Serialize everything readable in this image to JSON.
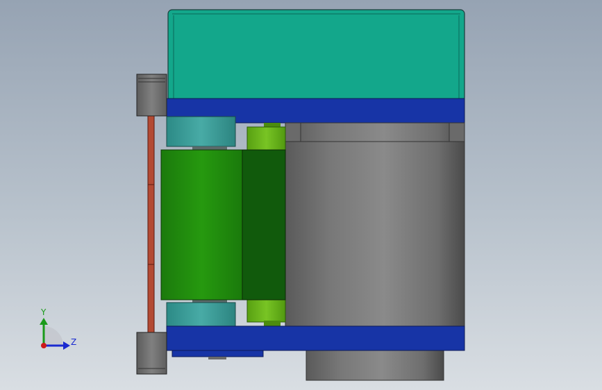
{
  "viewport": {
    "background_top": "#96a3b3",
    "background_bottom": "#d9dee3"
  },
  "model": {
    "parts": [
      {
        "name": "top-housing",
        "color": "#13a78b"
      },
      {
        "name": "blue-mounting-plate",
        "color": "#1734a6"
      },
      {
        "name": "teal-bearing-block",
        "color": "#3a9a96"
      },
      {
        "name": "green-roller",
        "color": "#1f8c0e"
      },
      {
        "name": "dark-green-roller",
        "color": "#115a0c"
      },
      {
        "name": "lime-shaft",
        "color": "#68b41a"
      },
      {
        "name": "motor-cylinder",
        "color": "#7a7a7a"
      },
      {
        "name": "side-guide-rod",
        "color": "#b34a33"
      },
      {
        "name": "grey-corner-block",
        "color": "#7a7a7a"
      }
    ]
  },
  "triad": {
    "y_label": "Y",
    "z_label": "Z",
    "y_color": "#1a9a1a",
    "z_color": "#1a2ad0",
    "origin_color": "#cc1a1a"
  }
}
